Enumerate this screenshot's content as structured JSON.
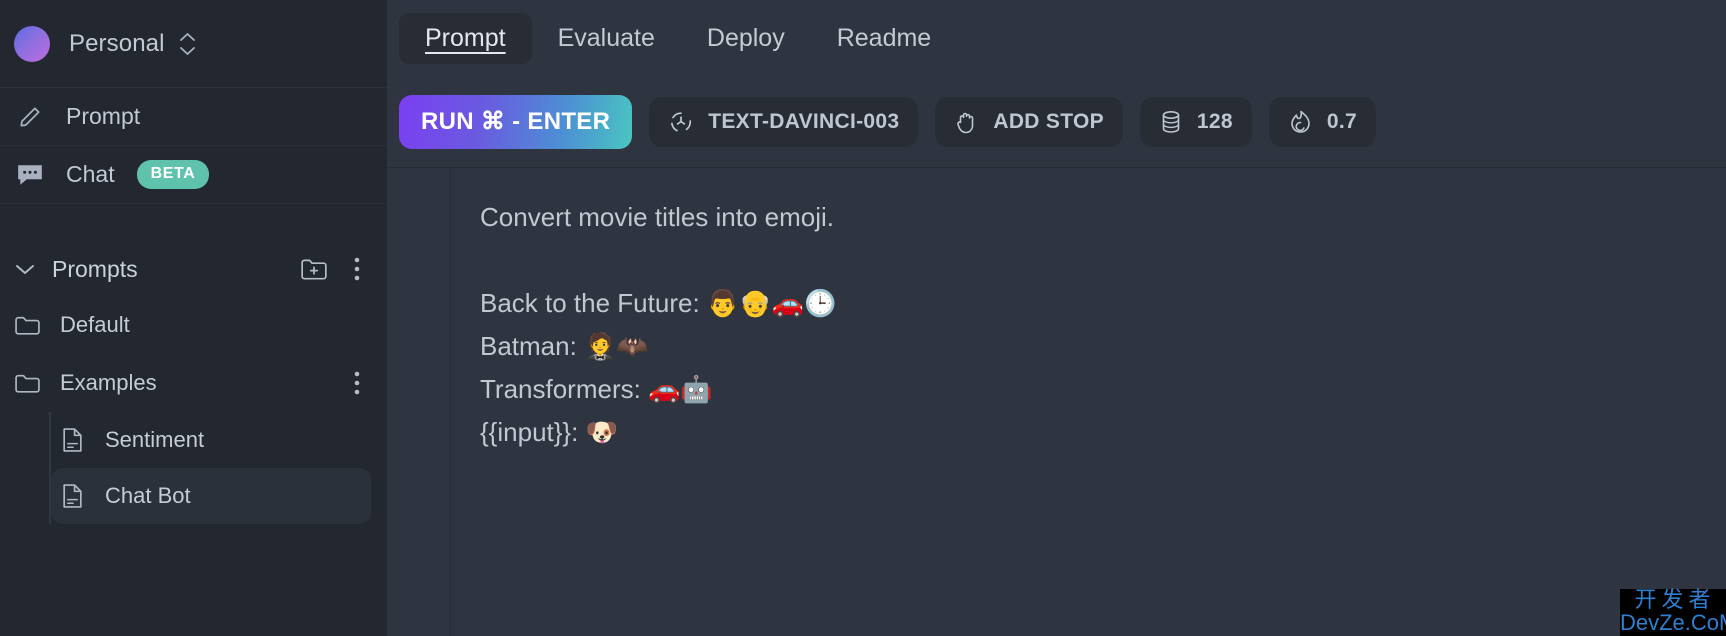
{
  "sidebar": {
    "workspace": {
      "name": "Personal",
      "avatar_gradient_from": "#5b6ce0",
      "avatar_gradient_to": "#c06ce0",
      "switch_icon": "chevron-up-down-icon"
    },
    "nav": [
      {
        "label": "Prompt",
        "icon": "pencil-icon",
        "badge": ""
      },
      {
        "label": "Chat",
        "icon": "chat-bubble-icon",
        "badge": "BETA"
      }
    ],
    "badge_color": "#5ec2ad",
    "prompts_section": {
      "title": "Prompts",
      "caret_icon": "chevron-down-icon",
      "new_folder_icon": "folder-plus-icon",
      "more_icon": "kebab-menu-icon"
    },
    "folders": [
      {
        "label": "Default",
        "icon": "folder-icon",
        "has_more": false,
        "children": []
      },
      {
        "label": "Examples",
        "icon": "folder-icon",
        "has_more": true,
        "children": [
          {
            "label": "Sentiment",
            "icon": "document-icon",
            "selected": false
          },
          {
            "label": "Chat Bot",
            "icon": "document-icon",
            "selected": true
          }
        ]
      }
    ]
  },
  "main": {
    "tabs": [
      {
        "label": "Prompt",
        "active": true
      },
      {
        "label": "Evaluate",
        "active": false
      },
      {
        "label": "Deploy",
        "active": false
      },
      {
        "label": "Readme",
        "active": false
      }
    ],
    "toolbar": {
      "run_label": "RUN ⌘ - ENTER",
      "model": {
        "label": "TEXT-DAVINCI-003",
        "icon": "model-node-icon"
      },
      "add_stop": {
        "label": "ADD STOP",
        "icon": "hand-stop-icon"
      },
      "max_tokens": {
        "label": "128",
        "icon": "database-stack-icon"
      },
      "temperature": {
        "label": "0.7",
        "icon": "flame-icon"
      }
    },
    "editor": {
      "content": "Convert movie titles into emoji.\n\nBack to the Future: 👨👴🚗🕒\nBatman: 🤵🦇\nTransformers: 🚗🤖\n{{input}}: 🐶"
    }
  },
  "watermark": {
    "line1": "开发者",
    "line2": "DevZe.CoM",
    "color": "#2f7fd0"
  }
}
